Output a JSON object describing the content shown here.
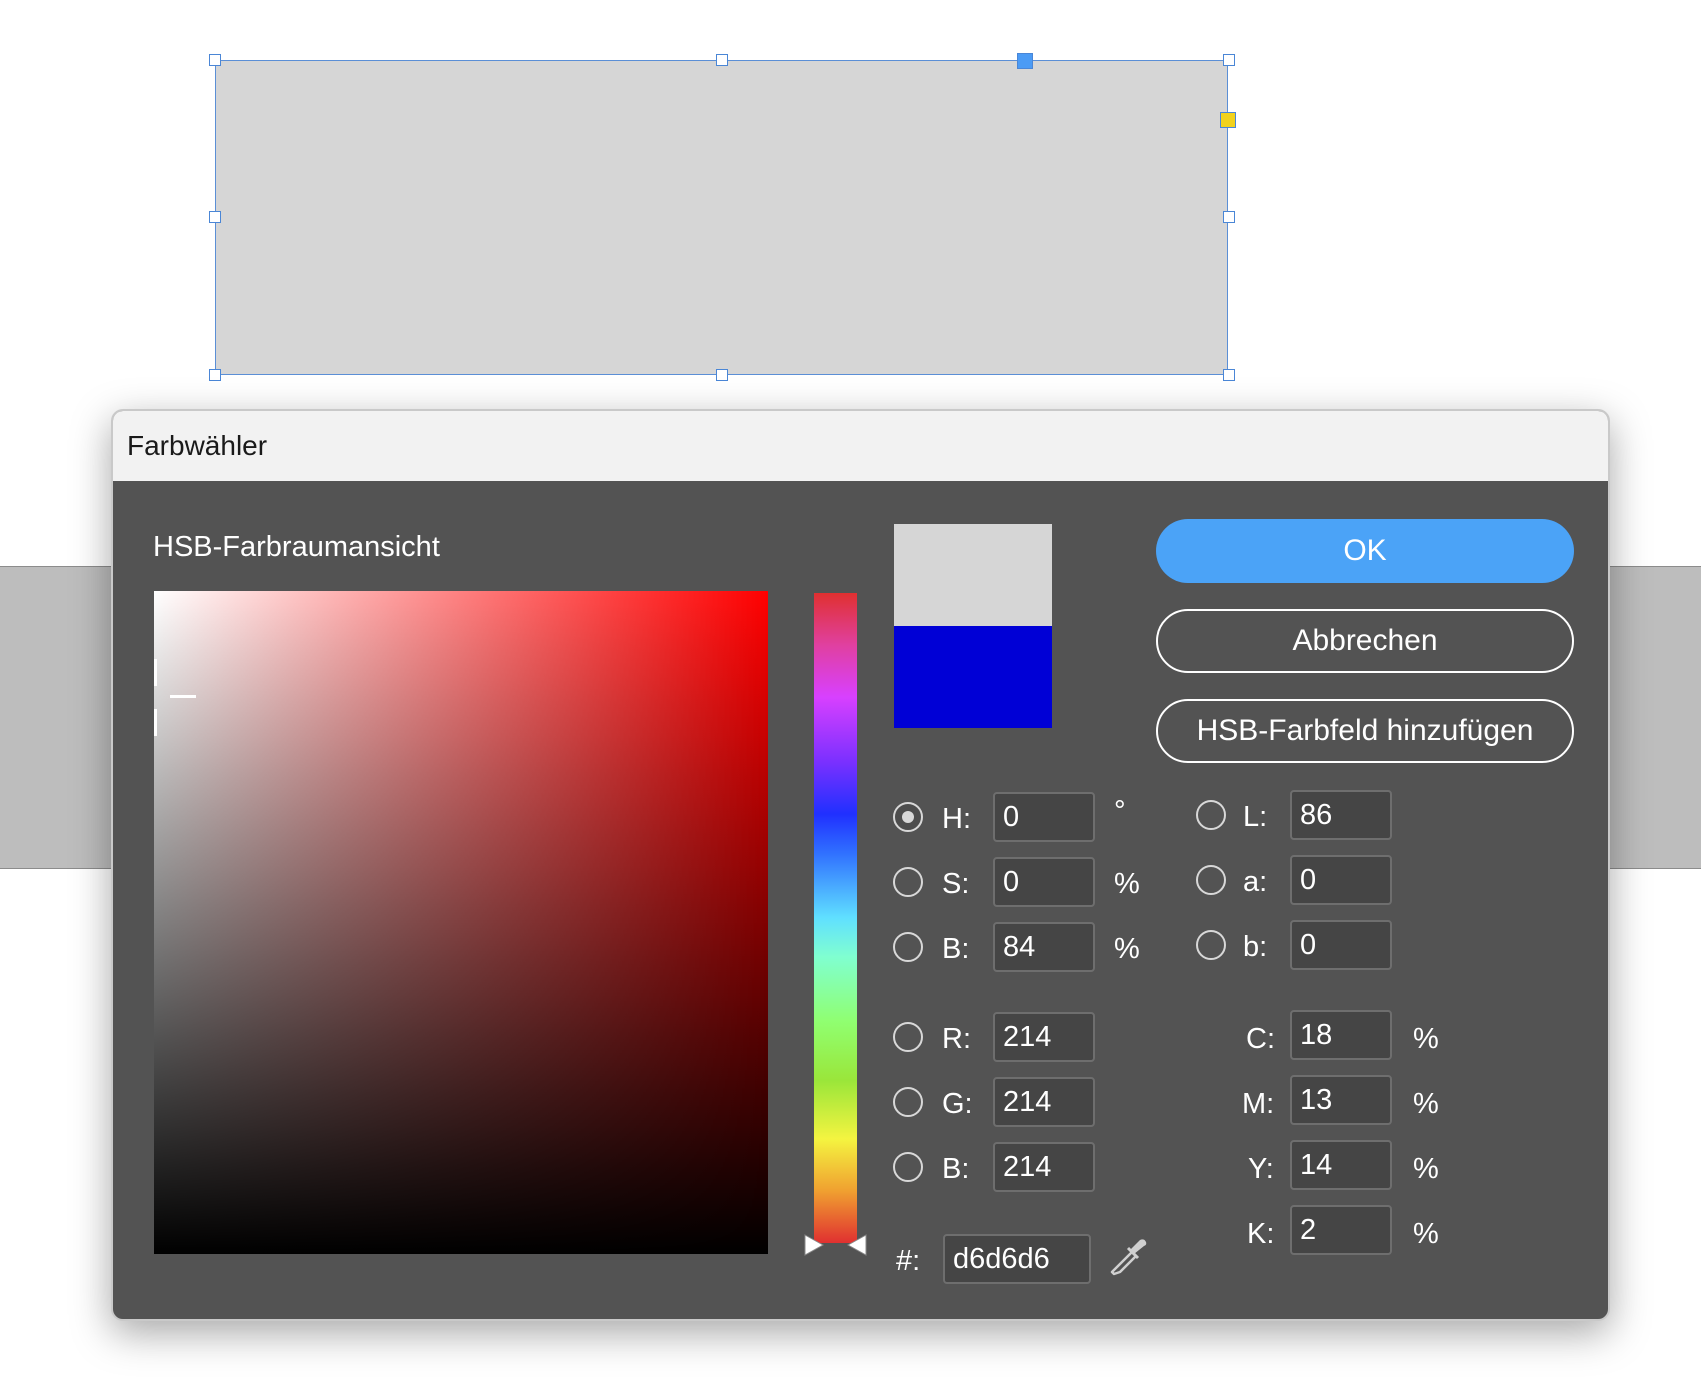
{
  "dialog": {
    "title": "Farbwähler",
    "section_label": "HSB-Farbraumansicht",
    "buttons": {
      "ok": "OK",
      "cancel": "Abbrechen",
      "add_swatch": "HSB-Farbfeld hinzufügen"
    },
    "swatches": {
      "new_color": "#d6d6d6",
      "original_color": "#0000d6"
    },
    "hsb": {
      "h": {
        "label": "H:",
        "value": "0",
        "unit": "°",
        "selected": true
      },
      "s": {
        "label": "S:",
        "value": "0",
        "unit": "%"
      },
      "b": {
        "label": "B:",
        "value": "84",
        "unit": "%"
      }
    },
    "rgb": {
      "r": {
        "label": "R:",
        "value": "214"
      },
      "g": {
        "label": "G:",
        "value": "214"
      },
      "b": {
        "label": "B:",
        "value": "214"
      }
    },
    "lab": {
      "l": {
        "label": "L:",
        "value": "86"
      },
      "a": {
        "label": "a:",
        "value": "0"
      },
      "b": {
        "label": "b:",
        "value": "0"
      }
    },
    "cmyk": {
      "c": {
        "label": "C:",
        "value": "18",
        "unit": "%"
      },
      "m": {
        "label": "M:",
        "value": "13",
        "unit": "%"
      },
      "y": {
        "label": "Y:",
        "value": "14",
        "unit": "%"
      },
      "k": {
        "label": "K:",
        "value": "2",
        "unit": "%"
      }
    },
    "hex": {
      "label": "#:",
      "value": "d6d6d6"
    }
  },
  "colors": {
    "accent": "#4ba3f7",
    "dialog_bg": "#535353",
    "frame_fill": "#d6d6d6"
  }
}
